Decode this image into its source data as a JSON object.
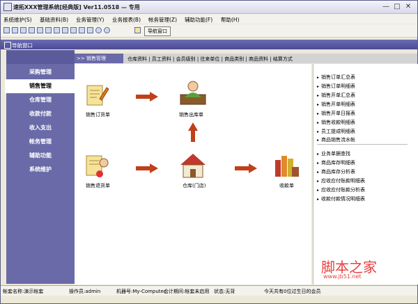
{
  "window": {
    "title": "速拓XXX管理系统[经典版] Ver11.0518 — 专用"
  },
  "menu": [
    "系统维护(S)",
    "基础资料(B)",
    "业务管理(Y)",
    "业务报表(B)",
    "帐务管理(Z)",
    "辅助功能(F)",
    "帮助(H)"
  ],
  "toolbar": {
    "nav_button": "导航窗口"
  },
  "nav": {
    "title": "导航窗口"
  },
  "sidebar": {
    "items": [
      "采购管理",
      "销售管理",
      "仓库管理",
      "收款付款",
      "收入支出",
      "帐务管理",
      "辅助功能",
      "系统维护"
    ],
    "active_index": 1
  },
  "tabs": {
    "current": ">> 销售管理",
    "items": [
      "仓库资料 | 员工资料 | 会员级别 | 往来单位 | 商品类别 | 商品资料 | 结算方式"
    ]
  },
  "flow": {
    "sales_order": "销售订货单",
    "sales_out": "销售出库单",
    "sales_return": "销售退货单",
    "warehouse": "仓库(门店)",
    "receipt": "收款单"
  },
  "right_links": {
    "group1": [
      "销售订单汇总表",
      "销售订单明细表",
      "销售开单汇总表",
      "销售开单明细表",
      "销售开单日报表",
      "销售收款明细表",
      "员工提成明细表",
      "商品销售流水帐"
    ],
    "group2": [
      "业务单据查找",
      "商品库存明细表",
      "商品库存分析表",
      "应收应付账款明细表",
      "应收应付账款分析表",
      "收款付款情况明细表"
    ]
  },
  "status": {
    "account": "帐套名称:演示帐套",
    "operator": "操作员:admin",
    "machine": "机器号:My-Computer",
    "period": "会计期间:帐套未启用",
    "state": "状态:无背",
    "birthday": "今天共有0位过生日的会员"
  },
  "watermark": {
    "cn": "脚本之家",
    "url": "www.jb51.net"
  },
  "colors": {
    "nav_purple": "#6a6aa8",
    "arrow_red": "#c0401a",
    "watermark_red": "#e84040"
  }
}
